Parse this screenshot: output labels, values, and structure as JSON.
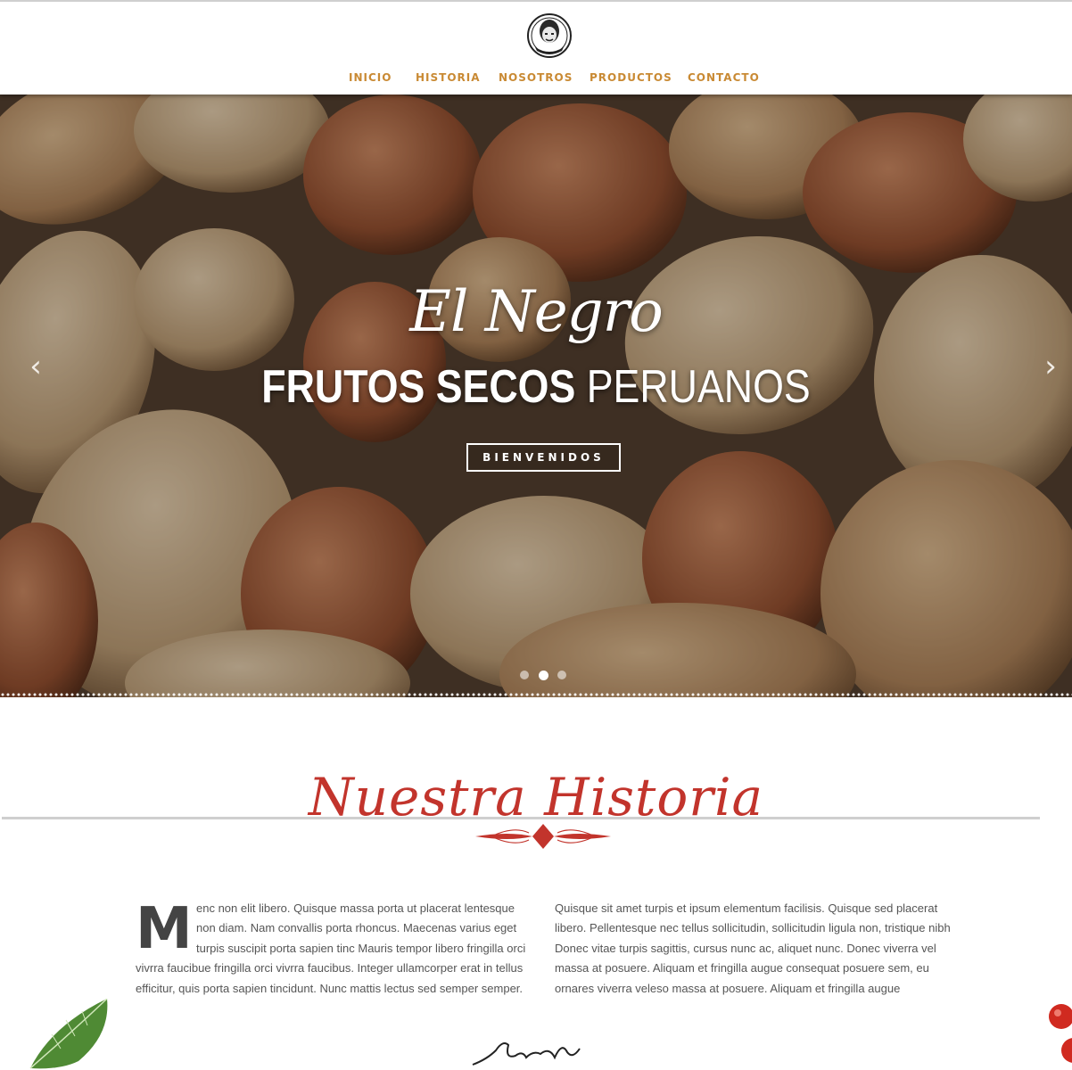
{
  "nav": {
    "items": [
      {
        "label": "INICIO"
      },
      {
        "label": "HISTORIA"
      },
      {
        "label": "NOSOTROS"
      },
      {
        "label": "PRODUCTOS"
      },
      {
        "label": "CONTACTO"
      }
    ]
  },
  "logo": {
    "text": "EL NEGRO"
  },
  "hero": {
    "script_title": "El Negro",
    "title_bold": "FRUTOS SECOS",
    "title_light": "PERUANOS",
    "button": "BIENVENIDOS",
    "slides": 3,
    "active_slide": 2,
    "prev_icon": "chevron-left-icon",
    "next_icon": "chevron-right-icon"
  },
  "historia": {
    "title": "Nuestra Historia",
    "dropcap": "M",
    "col1": "enc non elit libero. Quisque massa porta ut placerat lentesque non diam. Nam convallis porta rhoncus. Maecenas varius eget turpis suscipit porta sapien tinc Mauris tempor libero fringilla orci vivrra faucibue fringilla orci vivrra faucibus. Integer ullamcorper erat in tellus efficitur, quis porta sapien tincidunt. Nunc mattis lectus sed semper semper.",
    "col2": "Quisque sit amet turpis et ipsum elementum facilisis. Quisque sed placerat libero. Pellentesque nec tellus sollicitudin, sollicitudin ligula non, tristique nibh Donec vitae turpis sagittis, cursus nunc ac, aliquet nunc. Donec viverra vel massa at posuere. Aliquam et fringilla augue consequat posuere sem, eu ornares viverra veleso massa at posuere. Aliquam et fringilla augue"
  },
  "colors": {
    "nav": "#c98a34",
    "accent_red": "#c2342c",
    "text": "#555555"
  }
}
